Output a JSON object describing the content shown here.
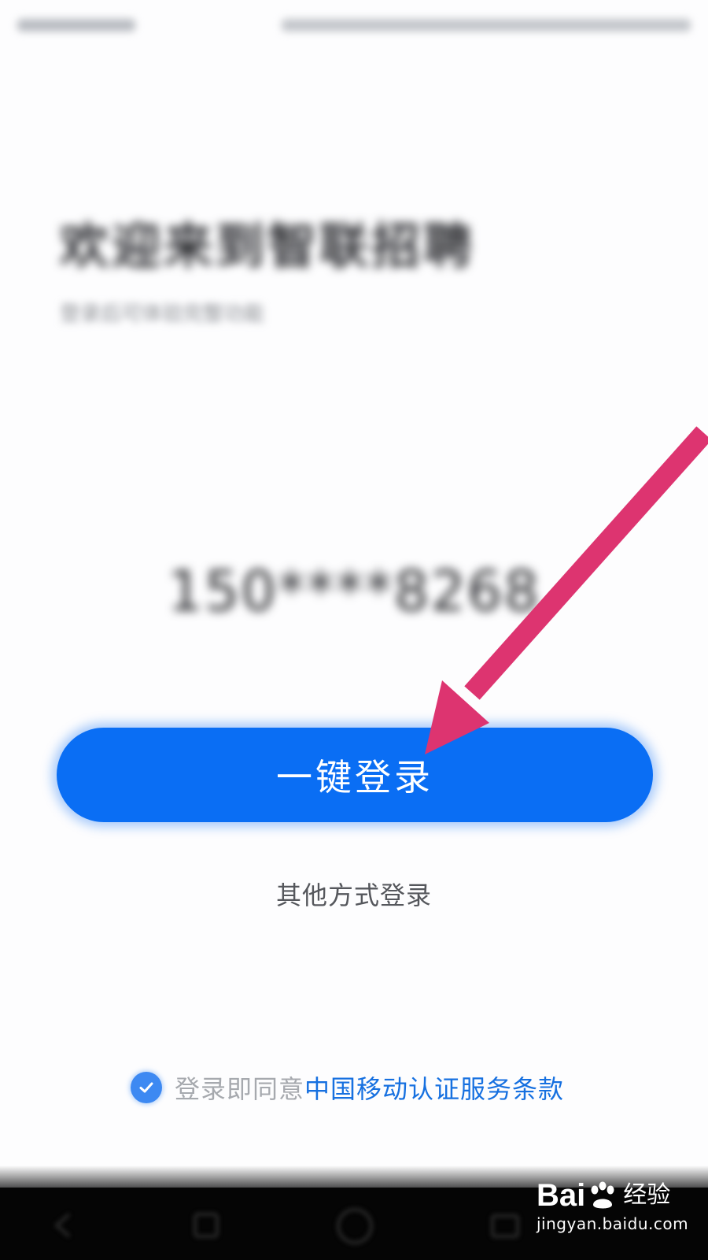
{
  "header": {
    "welcome_title": "欢迎来到智联招聘",
    "welcome_subtitle": "登录后可体验完整功能"
  },
  "login": {
    "masked_phone": "150****8268",
    "one_key_button_label": "一键登录",
    "other_methods_label": "其他方式登录"
  },
  "agreement": {
    "checked": true,
    "prefix_text": "登录即同意",
    "terms_link_text": "中国移动认证服务条款"
  },
  "watermark": {
    "brand_left": "Bai",
    "brand_right": "经验",
    "url": "jingyan.baidu.com"
  },
  "colors": {
    "primary": "#0a6ef4",
    "link": "#1670e0",
    "annotation_arrow": "#dd3470"
  }
}
